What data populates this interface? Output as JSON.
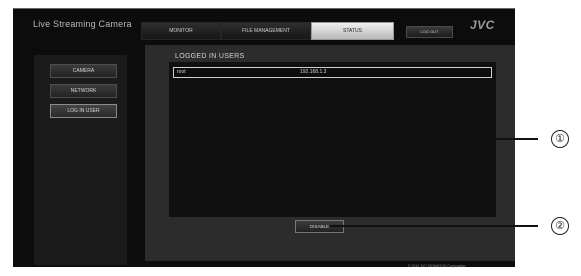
{
  "app": {
    "title": "Live Streaming Camera",
    "brand": "JVC",
    "copyright": "© 2012 JVC KENWOOD Corporation"
  },
  "nav": {
    "tabs": [
      {
        "label": "MONITOR",
        "active": false
      },
      {
        "label": "FILE MANAGEMENT",
        "active": false
      },
      {
        "label": "STATUS",
        "active": true
      }
    ],
    "logout_label": "LOG OUT"
  },
  "sidebar": {
    "items": [
      {
        "label": "CAMERA",
        "active": false
      },
      {
        "label": "NETWORK",
        "active": false
      },
      {
        "label": "LOG IN USER",
        "active": true
      }
    ]
  },
  "main": {
    "title": "LOGGED IN USERS",
    "users": [
      {
        "name": "root",
        "ip": "192.168.1.3"
      }
    ],
    "disable_label": "DISABLE"
  },
  "callouts": [
    "①",
    "②"
  ],
  "colors": {
    "background": "#0c0c0c",
    "panel": "#2c2c2c",
    "list": "#101010",
    "active_tab": "#d9d9d9"
  }
}
